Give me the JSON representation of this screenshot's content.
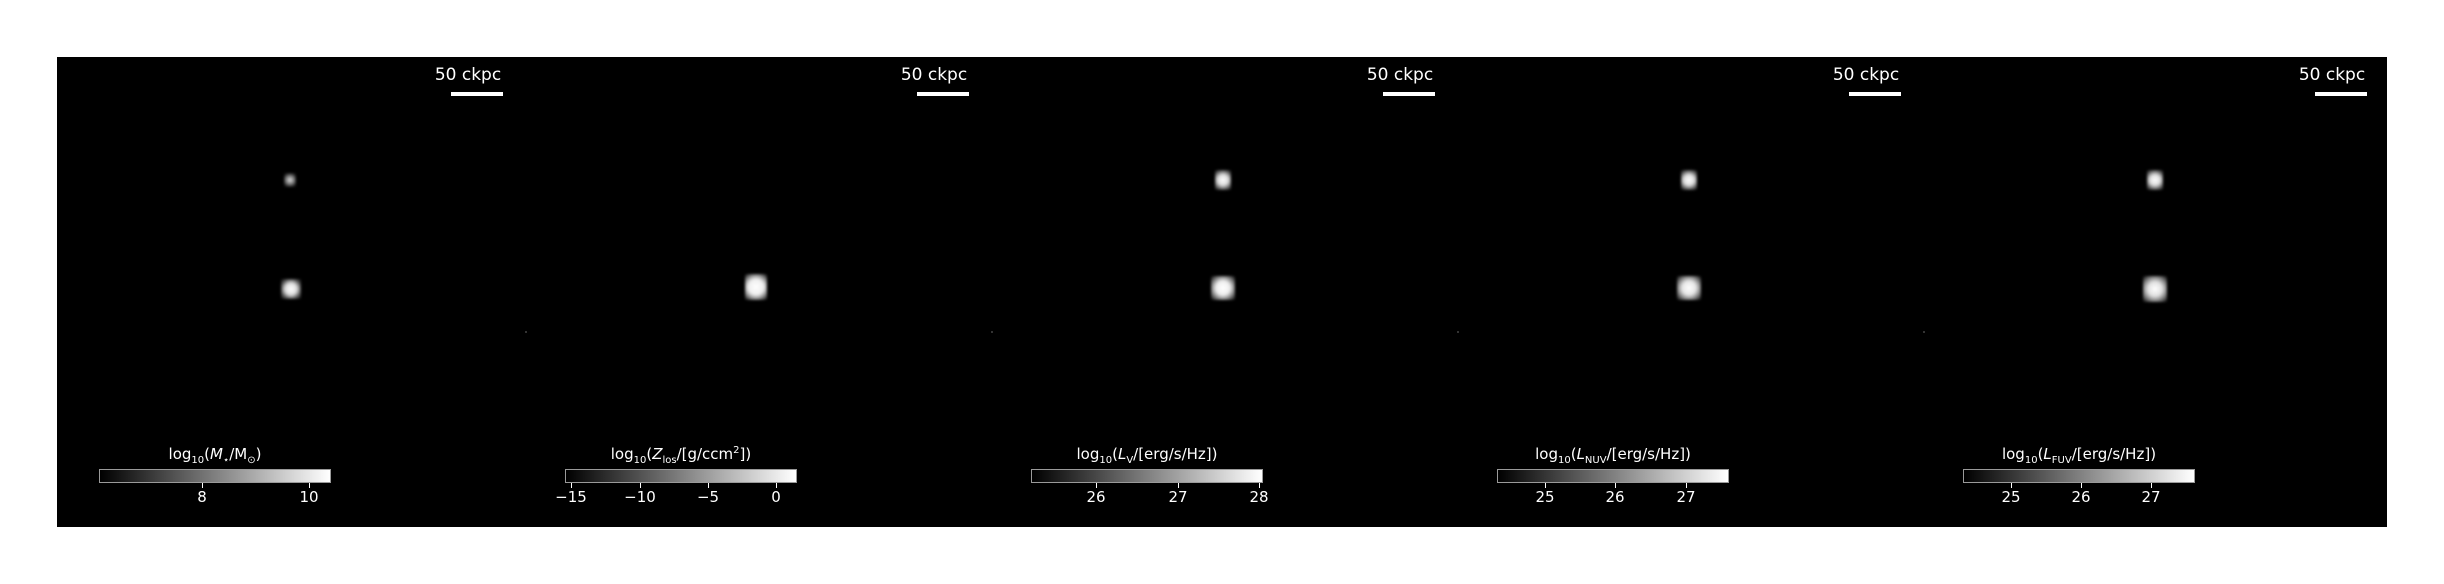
{
  "scalebar": "50 ckpc",
  "panels": [
    {
      "colorbar": {
        "prefix": "log",
        "sub": "10",
        "open": "(",
        "var": "M",
        "var_sub": "⋆",
        "mid": "/M",
        "mid_sub": "⊙",
        "rest": ")"
      },
      "ticks": [
        "8",
        "10"
      ]
    },
    {
      "colorbar": {
        "prefix": "log",
        "sub": "10",
        "open": "(",
        "var": "Z",
        "var_sub": "los",
        "mid": "/[g/ccm",
        "sup": "2",
        "rest": "])"
      },
      "ticks": [
        "−15",
        "−10",
        "−5",
        "0"
      ]
    },
    {
      "colorbar": {
        "prefix": "log",
        "sub": "10",
        "open": "(",
        "var": "L",
        "var_sub": "V",
        "mid": "/[erg/s/Hz])"
      },
      "ticks": [
        "26",
        "27",
        "28"
      ]
    },
    {
      "colorbar": {
        "prefix": "log",
        "sub": "10",
        "open": "(",
        "var": "L",
        "var_sub": "NUV",
        "mid": "/[erg/s/Hz])"
      },
      "ticks": [
        "25",
        "26",
        "27"
      ]
    },
    {
      "colorbar": {
        "prefix": "log",
        "sub": "10",
        "open": "(",
        "var": "L",
        "var_sub": "FUV",
        "mid": "/[erg/s/Hz])"
      },
      "ticks": [
        "25",
        "26",
        "27"
      ]
    }
  ]
}
